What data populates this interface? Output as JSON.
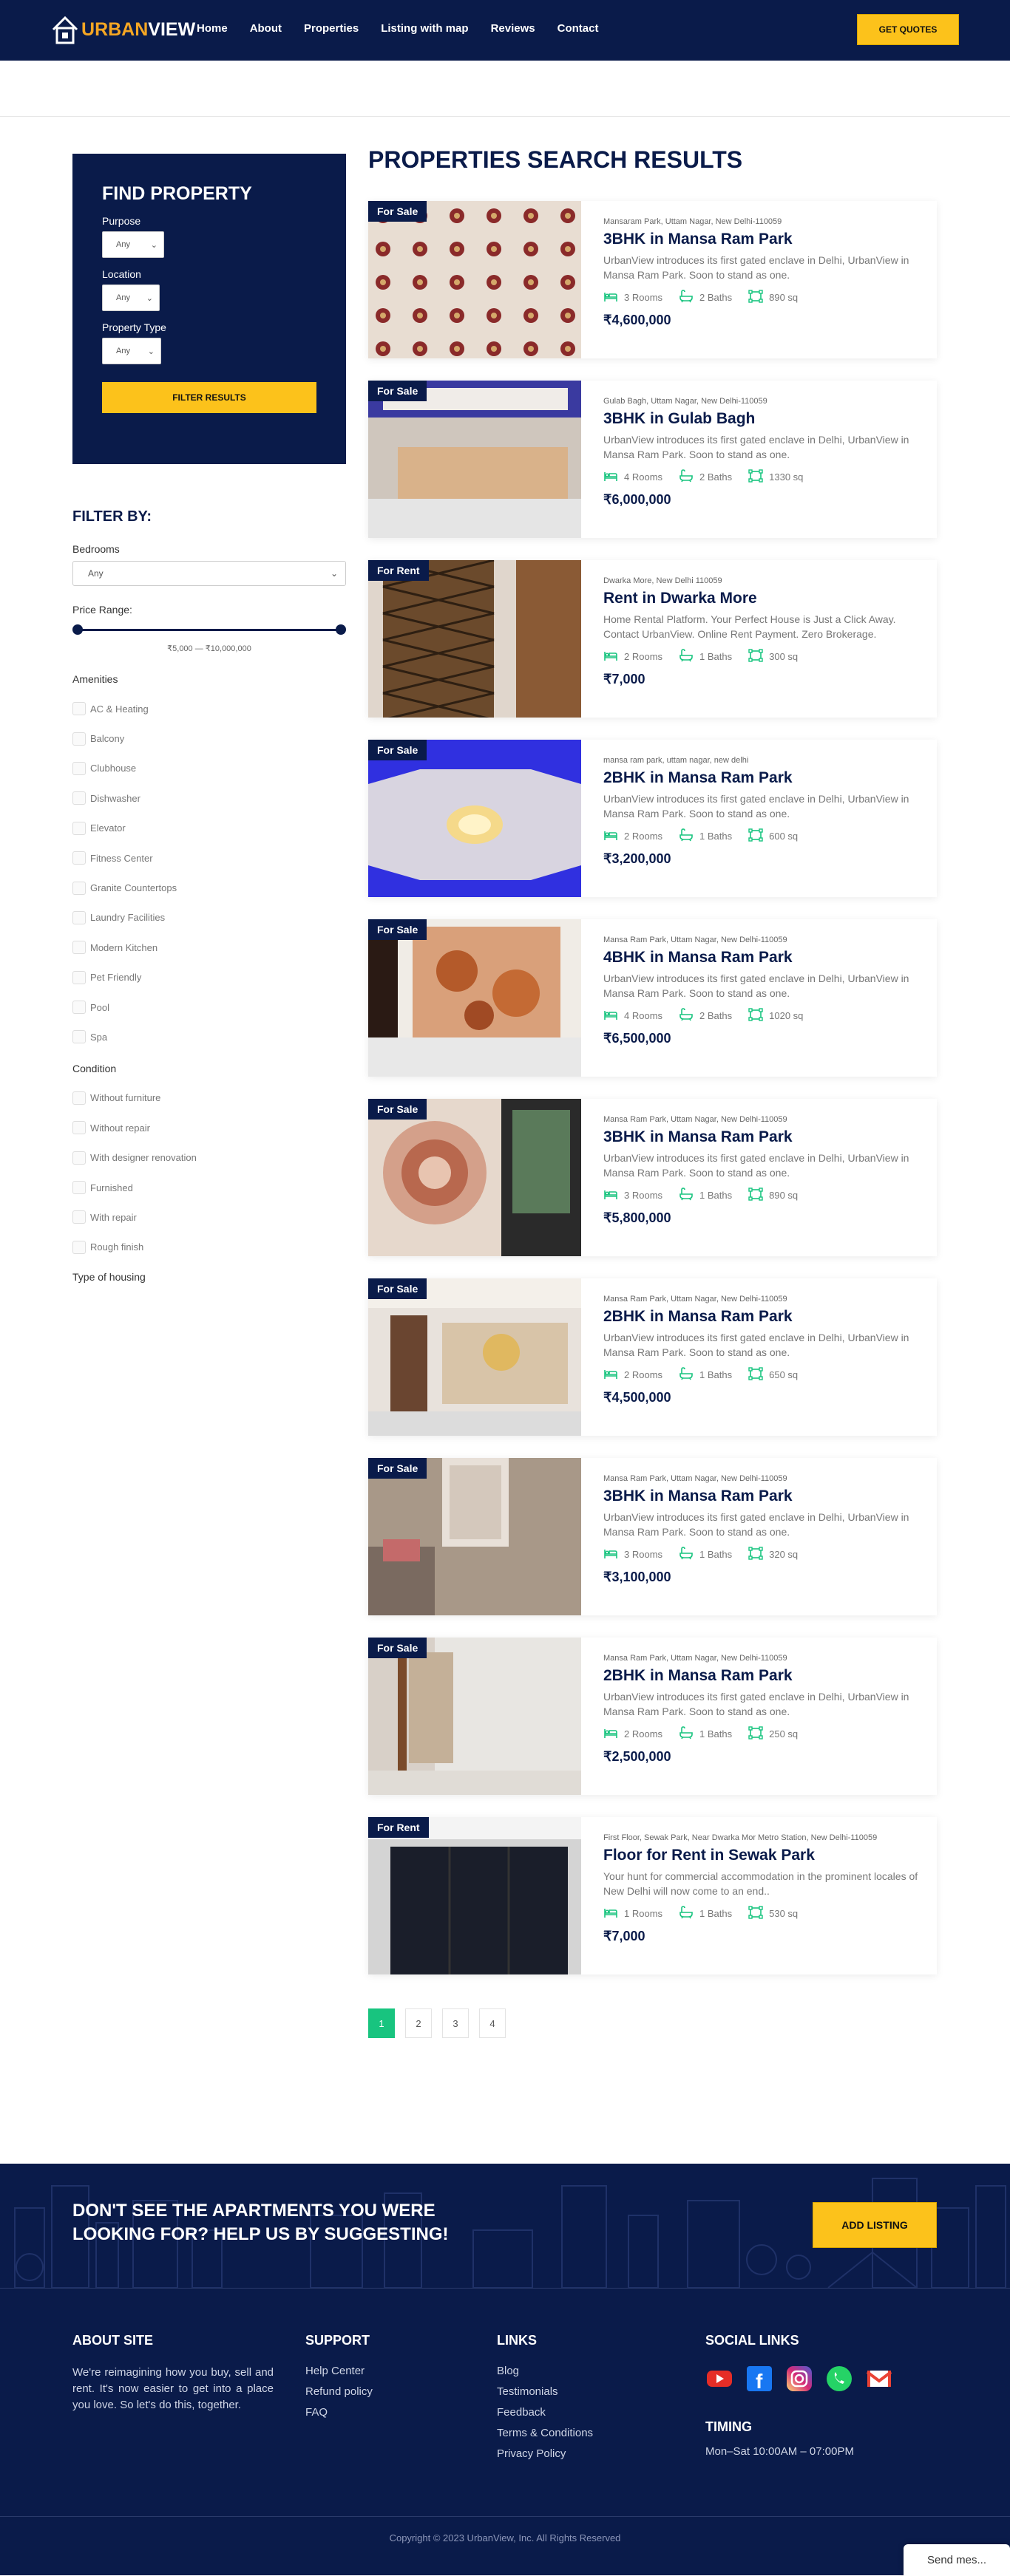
{
  "header": {
    "logo_text_u": "U",
    "logo_text_rest": "RBAN",
    "logo_text_view": "VIEW",
    "nav": [
      "Home",
      "About",
      "Properties",
      "Listing with map",
      "Reviews",
      "Contact"
    ],
    "quote_button": "GET QUOTES"
  },
  "search_panel": {
    "title": "FIND PROPERTY",
    "purpose_label": "Purpose",
    "purpose_value": "Any",
    "location_label": "Location",
    "location_value": "Any",
    "type_label": "Property Type",
    "type_value": "Any",
    "filter_button": "FILTER RESULTS"
  },
  "filter_by": {
    "title": "FILTER BY:",
    "bedrooms_label": "Bedrooms",
    "bedrooms_value": "Any",
    "price_label": "Price Range:",
    "price_range_text": "₹5,000 — ₹10,000,000",
    "amenities_label": "Amenities",
    "amenities": [
      "AC & Heating",
      "Balcony",
      "Clubhouse",
      "Dishwasher",
      "Elevator",
      "Fitness Center",
      "Granite Countertops",
      "Laundry Facilities",
      "Modern Kitchen",
      "Pet Friendly",
      "Pool",
      "Spa"
    ],
    "condition_label": "Condition",
    "conditions": [
      "Without furniture",
      "Without repair",
      "With designer renovation",
      "Furnished",
      "With repair",
      "Rough finish"
    ],
    "housing_label": "Type of housing"
  },
  "results": {
    "title": "PROPERTIES SEARCH RESULTS",
    "listings": [
      {
        "tag": "For Sale",
        "address": "Mansaram Park, Uttam Nagar, New Delhi-110059",
        "title": "3BHK in Mansa Ram Park",
        "desc": "UrbanView introduces its first gated enclave in Delhi, UrbanView in Mansa Ram Park. Soon to stand as one.",
        "rooms": "3 Rooms",
        "baths": "2 Baths",
        "area": "890 sq",
        "price": "₹4,600,000",
        "img": "wallpaper"
      },
      {
        "tag": "For Sale",
        "address": "Gulab Bagh, Uttam Nagar, New Delhi-110059",
        "title": "3BHK in Gulab Bagh",
        "desc": "UrbanView introduces its first gated enclave in Delhi, UrbanView in Mansa Ram Park. Soon to stand as one.",
        "rooms": "4 Rooms",
        "baths": "2 Baths",
        "area": "1330 sq",
        "price": "₹6,000,000",
        "img": "kitchen"
      },
      {
        "tag": "For Rent",
        "address": "Dwarka More, New Delhi 110059",
        "title": "Rent in Dwarka More",
        "desc": "Home Rental Platform. Your Perfect House is Just a Click Away. Contact UrbanView. Online Rent Payment. Zero Brokerage.",
        "rooms": "2 Rooms",
        "baths": "1 Baths",
        "area": "300 sq",
        "price": "₹7,000",
        "img": "door"
      },
      {
        "tag": "For Sale",
        "address": "mansa ram park, uttam nagar, new delhi",
        "title": "2BHK in Mansa Ram Park",
        "desc": "UrbanView introduces its first gated enclave in Delhi, UrbanView in Mansa Ram Park. Soon to stand as one.",
        "rooms": "2 Rooms",
        "baths": "1 Baths",
        "area": "600 sq",
        "price": "₹3,200,000",
        "img": "ceiling"
      },
      {
        "tag": "For Sale",
        "address": "Mansa Ram Park, Uttam Nagar, New Delhi-110059",
        "title": "4BHK in Mansa Ram Park",
        "desc": "UrbanView introduces its first gated enclave in Delhi, UrbanView in Mansa Ram Park. Soon to stand as one.",
        "rooms": "4 Rooms",
        "baths": "2 Baths",
        "area": "1020 sq",
        "price": "₹6,500,000",
        "img": "floral"
      },
      {
        "tag": "For Sale",
        "address": "Mansa Ram Park, Uttam Nagar, New Delhi-110059",
        "title": "3BHK in Mansa Ram Park",
        "desc": "UrbanView introduces its first gated enclave in Delhi, UrbanView in Mansa Ram Park. Soon to stand as one.",
        "rooms": "3 Rooms",
        "baths": "1 Baths",
        "area": "890 sq",
        "price": "₹5,800,000",
        "img": "rose"
      },
      {
        "tag": "For Sale",
        "address": "Mansa Ram Park, Uttam Nagar, New Delhi-110059",
        "title": "2BHK in Mansa Ram Park",
        "desc": "UrbanView introduces its first gated enclave in Delhi, UrbanView in Mansa Ram Park. Soon to stand as one.",
        "rooms": "2 Rooms",
        "baths": "1 Baths",
        "area": "650 sq",
        "price": "₹4,500,000",
        "img": "room"
      },
      {
        "tag": "For Sale",
        "address": "Mansa Ram Park, Uttam Nagar, New Delhi-110059",
        "title": "3BHK in Mansa Ram Park",
        "desc": "UrbanView introduces its first gated enclave in Delhi, UrbanView in Mansa Ram Park. Soon to stand as one.",
        "rooms": "3 Rooms",
        "baths": "1 Baths",
        "area": "320 sq",
        "price": "₹3,100,000",
        "img": "tiles"
      },
      {
        "tag": "For Sale",
        "address": "Mansa Ram Park, Uttam Nagar, New Delhi-110059",
        "title": "2BHK in Mansa Ram Park",
        "desc": "UrbanView introduces its first gated enclave in Delhi, UrbanView in Mansa Ram Park. Soon to stand as one.",
        "rooms": "2 Rooms",
        "baths": "1 Baths",
        "area": "250 sq",
        "price": "₹2,500,000",
        "img": "plain"
      },
      {
        "tag": "For Rent",
        "address": "First Floor, Sewak Park, Near Dwarka Mor Metro Station, New Delhi-110059",
        "title": "Floor for Rent in Sewak Park",
        "desc": "Your hunt for commercial accommodation in the prominent locales of New Delhi will now come to an end..",
        "rooms": "1 Rooms",
        "baths": "1 Baths",
        "area": "530 sq",
        "price": "₹7,000",
        "img": "dark"
      }
    ]
  },
  "pagination": [
    "1",
    "2",
    "3",
    "4"
  ],
  "cta": {
    "text": "DON'T SEE THE APARTMENTS YOU WERE LOOKING FOR? HELP US BY SUGGESTING!",
    "button": "ADD LISTING"
  },
  "footer": {
    "about_title": "ABOUT SITE",
    "about_text": "We're reimagining how you buy, sell and rent. It's now easier to get into a place you love. So let's do this, together.",
    "support_title": "SUPPORT",
    "support_links": [
      "Help Center",
      "Refund policy",
      "FAQ"
    ],
    "links_title": "LINKS",
    "links": [
      "Blog",
      "Testimonials",
      "Feedback",
      "Terms & Conditions",
      "Privacy Policy"
    ],
    "social_title": "SOCIAL LINKS",
    "timing_title": "TIMING",
    "timing_text": "Mon–Sat  10:00AM – 07:00PM",
    "copyright": "Copyright © 2023 UrbanView, Inc. All Rights Reserved",
    "send_message": "Send mes..."
  },
  "colors": {
    "navy": "#0a1b4a",
    "yellow": "#fcc21b",
    "green": "#18c47f",
    "orange": "#f5a623"
  }
}
